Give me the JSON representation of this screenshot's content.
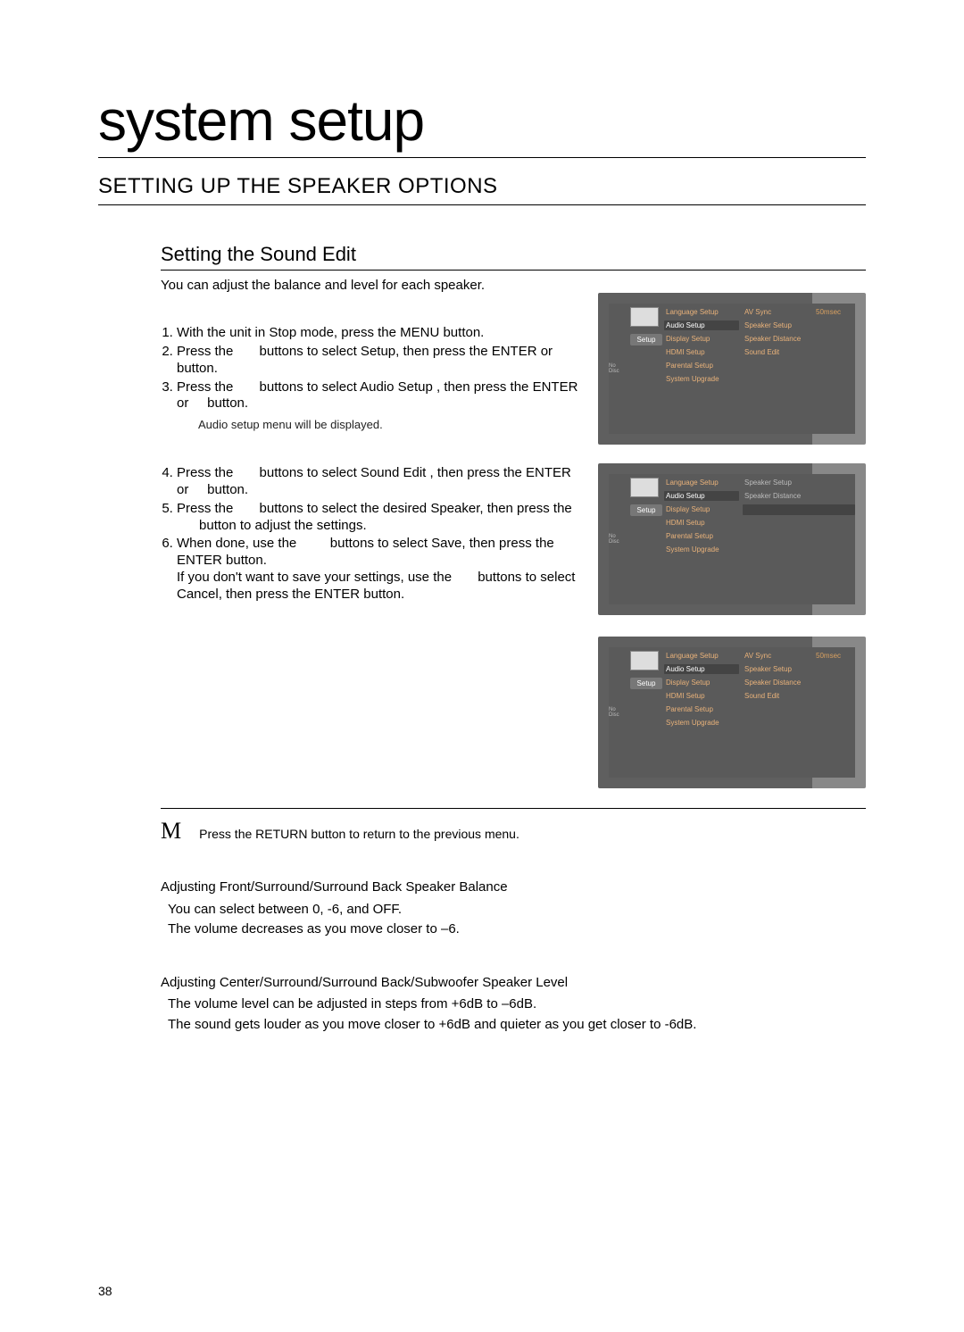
{
  "page_number": "38",
  "title": "system setup",
  "section_heading": "SETTING UP THE SPEAKER OPTIONS",
  "sub_heading": "Setting the Sound Edit",
  "intro": "You can adjust the balance and level for each speaker.",
  "steps_a": {
    "s1": "With the unit in Stop mode, press the MENU button.",
    "s2": "Press the       buttons to select Setup, then press the ENTER or     button.",
    "s3": "Press the       buttons to select Audio Setup , then press the ENTER or     button.",
    "s3_note": "Audio setup menu will be displayed."
  },
  "steps_b": {
    "s4": "Press the       buttons to select Sound Edit , then press the ENTER or     button.",
    "s5": "Press the       buttons to select the desired Speaker, then press the       button to adjust the settings.",
    "s6": "When done, use the         buttons to select Save, then press the ENTER button.\nIf you don't want to save your settings, use the       buttons to select Cancel, then press the ENTER button."
  },
  "note_mark": "M",
  "note_text": "Press the RETURN button to return to the previous menu.",
  "adjust_balance": {
    "title": "Adjusting Front/Surround/Surround Back Speaker Balance",
    "l1": "You can select between 0, -6, and OFF.",
    "l2": "The volume decreases as you move closer to –6."
  },
  "adjust_level": {
    "title": "Adjusting Center/Surround/Surround Back/Subwoofer Speaker Level",
    "l1": "The volume level can be adjusted in steps from +6dB to –6dB.",
    "l2": "The sound gets louder as you move closer to +6dB and quieter as you get closer to -6dB."
  },
  "osd1": {
    "side": "No Disc",
    "tab": "Setup",
    "col2": [
      "Language Setup",
      "Audio Setup",
      "Display Setup",
      "HDMI Setup",
      "Parental Setup",
      "System Upgrade"
    ],
    "selected2": "Audio Setup",
    "col3a": [
      "AV Sync",
      "Speaker Setup",
      "Speaker Distance",
      "Sound Edit"
    ],
    "col3b": [
      "50msec"
    ]
  },
  "osd2": {
    "side": "No Disc",
    "tab": "Setup",
    "col2": [
      "Language Setup",
      "Audio Setup",
      "Display Setup",
      "HDMI Setup",
      "Parental Setup",
      "System Upgrade"
    ],
    "selected2": "Audio Setup",
    "col3a": [
      "Speaker Setup",
      "Speaker Distance"
    ],
    "highlight_row": true
  },
  "osd3": {
    "side": "No Disc",
    "tab": "Setup",
    "col2": [
      "Language Setup",
      "Audio Setup",
      "Display Setup",
      "HDMI Setup",
      "Parental Setup",
      "System Upgrade"
    ],
    "selected2": "Audio Setup",
    "col3a": [
      "AV Sync",
      "Speaker Setup",
      "Speaker Distance",
      "Sound Edit"
    ],
    "col3b": [
      "50msec"
    ]
  }
}
